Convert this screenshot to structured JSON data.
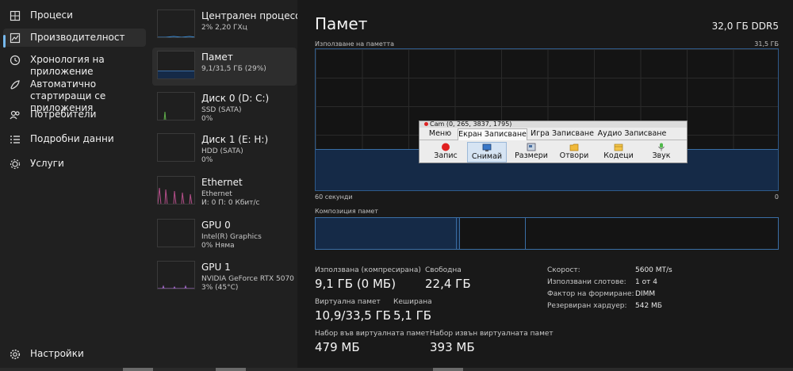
{
  "nav": {
    "items": [
      {
        "label": "Процеси",
        "icon": "processes-icon"
      },
      {
        "label": "Производителност",
        "icon": "performance-icon"
      },
      {
        "label": "Хронология на приложение",
        "icon": "history-icon"
      },
      {
        "label": "Автоматично стартиращи се приложения",
        "icon": "startup-icon"
      },
      {
        "label": "Потребители",
        "icon": "users-icon"
      },
      {
        "label": "Подробни данни",
        "icon": "details-icon"
      },
      {
        "label": "Услуги",
        "icon": "services-icon"
      }
    ],
    "settings_label": "Настройки"
  },
  "resources": [
    {
      "name": "Централен процесор",
      "sub1": "2%  2,20 ГХц",
      "sub2": ""
    },
    {
      "name": "Памет",
      "sub1": "9,1/31,5 ГБ (29%)",
      "sub2": ""
    },
    {
      "name": "Диск 0 (D: C:)",
      "sub1": "SSD (SATA)",
      "sub2": "0%"
    },
    {
      "name": "Диск 1 (E: H:)",
      "sub1": "HDD (SATA)",
      "sub2": "0%"
    },
    {
      "name": "Ethernet",
      "sub1": "Ethernet",
      "sub2": "И: 0  П: 0 Кбит/с"
    },
    {
      "name": "GPU 0",
      "sub1": "Intel(R) Graphics",
      "sub2": "0%  Няма"
    },
    {
      "name": "GPU 1",
      "sub1": "NVIDIA GeForce RTX 5070",
      "sub2": "3%  (45°C)"
    }
  ],
  "main": {
    "title": "Памет",
    "total": "32,0 ГБ DDR5",
    "graph_label": "Използване на паметта",
    "graph_max": "31,5 ГБ",
    "graph_time": "60 секунди",
    "graph_min": "0",
    "usage_fraction": 0.29,
    "composition_label": "Композиция памет",
    "stats": [
      {
        "label": "Използвана (компресирана)",
        "value": "9,1 ГБ (0 МБ)"
      },
      {
        "label": "Свободна",
        "value": "22,4 ГБ"
      },
      {
        "label": "Виртуална памет",
        "value": "10,9/33,5 ГБ"
      },
      {
        "label": "Кеширана",
        "value": "5,1 ГБ"
      },
      {
        "label": "Набор във виртуалната памет",
        "value": "479 МБ"
      },
      {
        "label": "Набор извън виртуалната памет",
        "value": "393 МБ"
      }
    ],
    "details": [
      {
        "label": "Скорост:",
        "value": "5600 MT/s"
      },
      {
        "label": "Използвани слотове:",
        "value": "1 от 4"
      },
      {
        "label": "Фактор на формиране:",
        "value": "DIMM"
      },
      {
        "label": "Резервиран хардуер:",
        "value": "542 МБ"
      }
    ]
  },
  "cam": {
    "title": "Cam (0, 265, 3837, 1795)",
    "tabs": [
      "Меню",
      "Екран Записване",
      "Игра Записване",
      "Аудио Записване"
    ],
    "buttons": [
      {
        "label": "Запис",
        "icon": "record-icon"
      },
      {
        "label": "Снимай",
        "icon": "screenshot-icon"
      },
      {
        "label": "Размери",
        "icon": "dimensions-icon"
      },
      {
        "label": "Отвори",
        "icon": "folder-icon"
      },
      {
        "label": "Кодеци",
        "icon": "codecs-icon"
      },
      {
        "label": "Звук",
        "icon": "microphone-icon"
      }
    ]
  },
  "colors": {
    "accent": "#76b9ed",
    "memory_fill": "#152a47",
    "memory_line": "#3a6ea5"
  }
}
